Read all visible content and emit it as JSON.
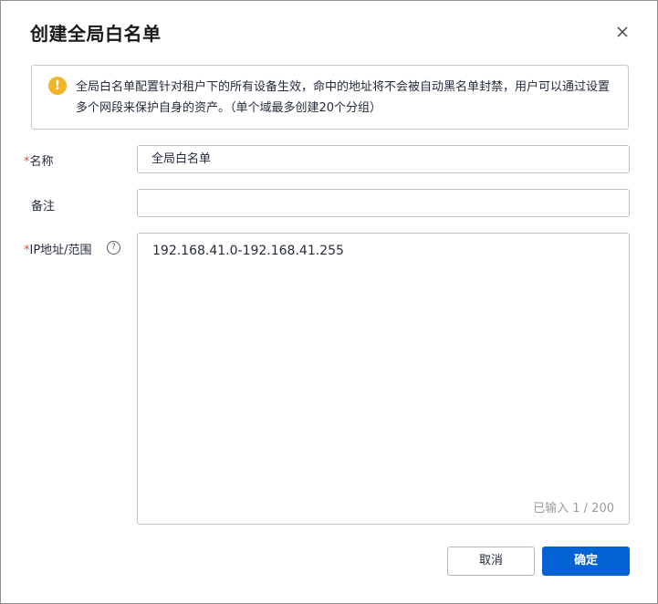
{
  "dialog": {
    "title": "创建全局白名单"
  },
  "alert": {
    "icon": "warning-icon",
    "text": "全局白名单配置针对租户下的所有设备生效，命中的地址将不会被自动黑名单封禁，用户可以通过设置多个网段来保护自身的资产。（单个域最多创建20个分组）"
  },
  "form": {
    "name": {
      "required_mark": "*",
      "label": "名称",
      "value": "全局白名单"
    },
    "remark": {
      "label": "备注",
      "value": ""
    },
    "ip": {
      "required_mark": "*",
      "label": "IP地址/范围",
      "value": "192.168.41.0-192.168.41.255",
      "counter": "已输入 1 / 200"
    }
  },
  "footer": {
    "cancel_label": "取消",
    "ok_label": "确定"
  },
  "colors": {
    "primary": "#0062d3",
    "warning": "#f0b429",
    "required": "#e0474a"
  }
}
